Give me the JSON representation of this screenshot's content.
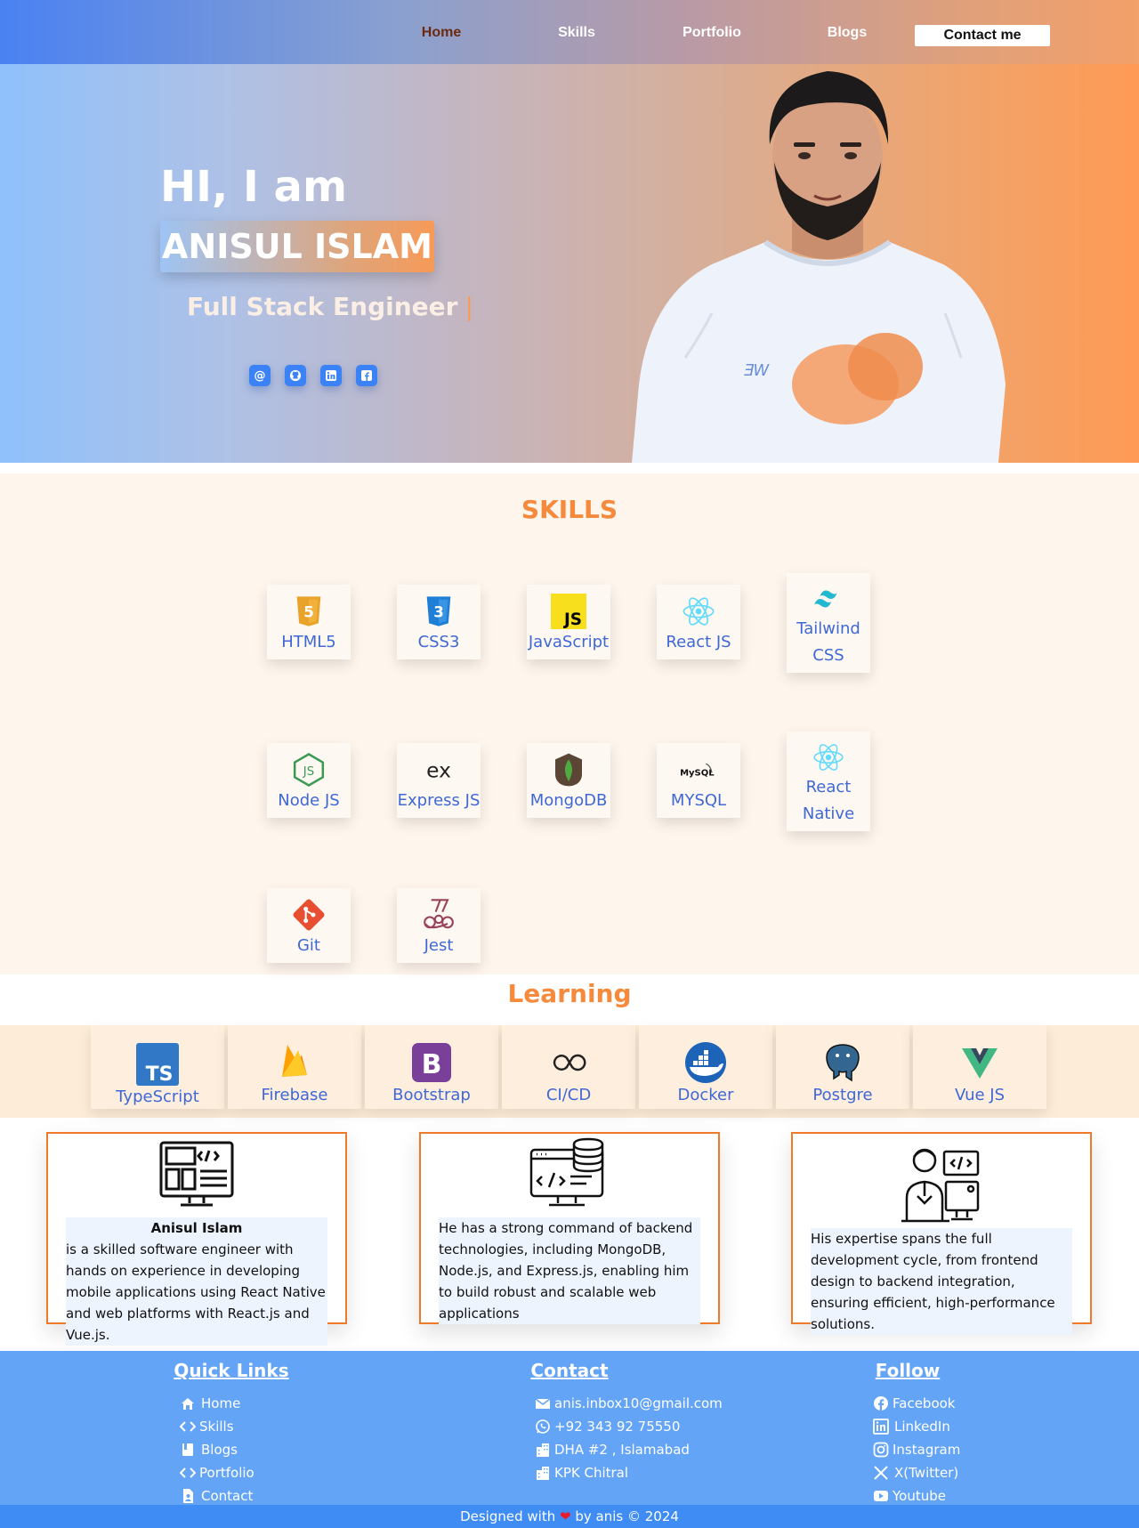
{
  "nav": {
    "items": [
      "Home",
      "Skills",
      "Portfolio",
      "Blogs"
    ],
    "contact_label": "Contact me"
  },
  "hero": {
    "greeting": "HI, I am",
    "name": "ANISUL ISLAM",
    "role": "Full Stack Engineer",
    "caret": "|",
    "socials": [
      "email-icon",
      "github-icon",
      "linkedin-icon",
      "facebook-icon"
    ]
  },
  "skills": {
    "title": "SKILLS",
    "items": [
      "HTML5",
      "CSS3",
      "JavaScript",
      "React JS",
      "Tailwind CSS",
      "Node JS",
      "Express JS",
      "MongoDB",
      "MYSQL",
      "React Native",
      "Git",
      "Jest"
    ]
  },
  "learning": {
    "title": "Learning",
    "items": [
      "TypeScript",
      "Firebase",
      "Bootstrap",
      "CI/CD",
      "Docker",
      "Postgre",
      "Vue JS"
    ]
  },
  "about": {
    "card1_name": "Anisul Islam",
    "card1_text": "is a skilled software engineer with hands on experience in developing mobile applications using React Native and web platforms with React.js and Vue.js.",
    "card2_text": "He has a strong command of backend technologies, including MongoDB, Node.js, and Express.js, enabling him to build robust and scalable web applications",
    "card3_text": "His expertise spans the full development cycle, from frontend design to backend integration, ensuring efficient, high-performance solutions."
  },
  "footer": {
    "quick_title": "Quick Links",
    "quick_links": [
      "Home",
      "Skills",
      "Blogs",
      "Portfolio",
      "Contact"
    ],
    "contact_title": "Contact",
    "contact_items": [
      "anis.inbox10@gmail.com",
      "+92 343 92 75550",
      "DHA #2 , Islamabad",
      "KPK Chitral"
    ],
    "follow_title": "Follow",
    "follow_items": [
      "Facebook",
      "LinkedIn",
      "Instagram",
      "X(Twitter)",
      "Youtube"
    ],
    "bottom_prefix": "Designed with",
    "bottom_suffix": "by anis © 2024"
  },
  "colors": {
    "accent": "#f58a3c",
    "link_blue": "#3f68d6",
    "footer_bg": "#63a4f7"
  }
}
